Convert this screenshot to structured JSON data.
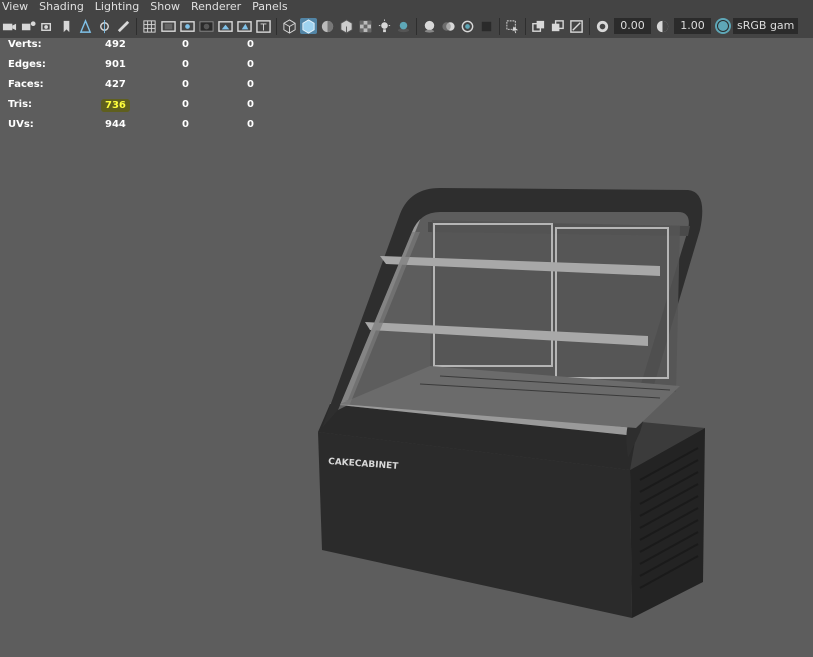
{
  "menubar": {
    "items": [
      "View",
      "Shading",
      "Lighting",
      "Show",
      "Renderer",
      "Panels"
    ]
  },
  "toolbar": {
    "exposure": "0.00",
    "gamma": "1.00",
    "color_space": "sRGB gam"
  },
  "hud": {
    "rows": [
      {
        "label": "Verts:",
        "values": [
          "492",
          "0",
          "0"
        ]
      },
      {
        "label": "Edges:",
        "values": [
          "901",
          "0",
          "0"
        ]
      },
      {
        "label": "Faces:",
        "values": [
          "427",
          "0",
          "0"
        ]
      },
      {
        "label": "Tris:",
        "values": [
          "736",
          "0",
          "0"
        ]
      },
      {
        "label": "UVs:",
        "values": [
          "944",
          "0",
          "0"
        ]
      }
    ]
  },
  "model": {
    "brand_text": "CAKECABINET"
  },
  "colors": {
    "viewport_bg": "#5d5d5d",
    "toolbar_bg": "#444444",
    "active": "#5285a6",
    "highlight": "#ffff3c"
  }
}
